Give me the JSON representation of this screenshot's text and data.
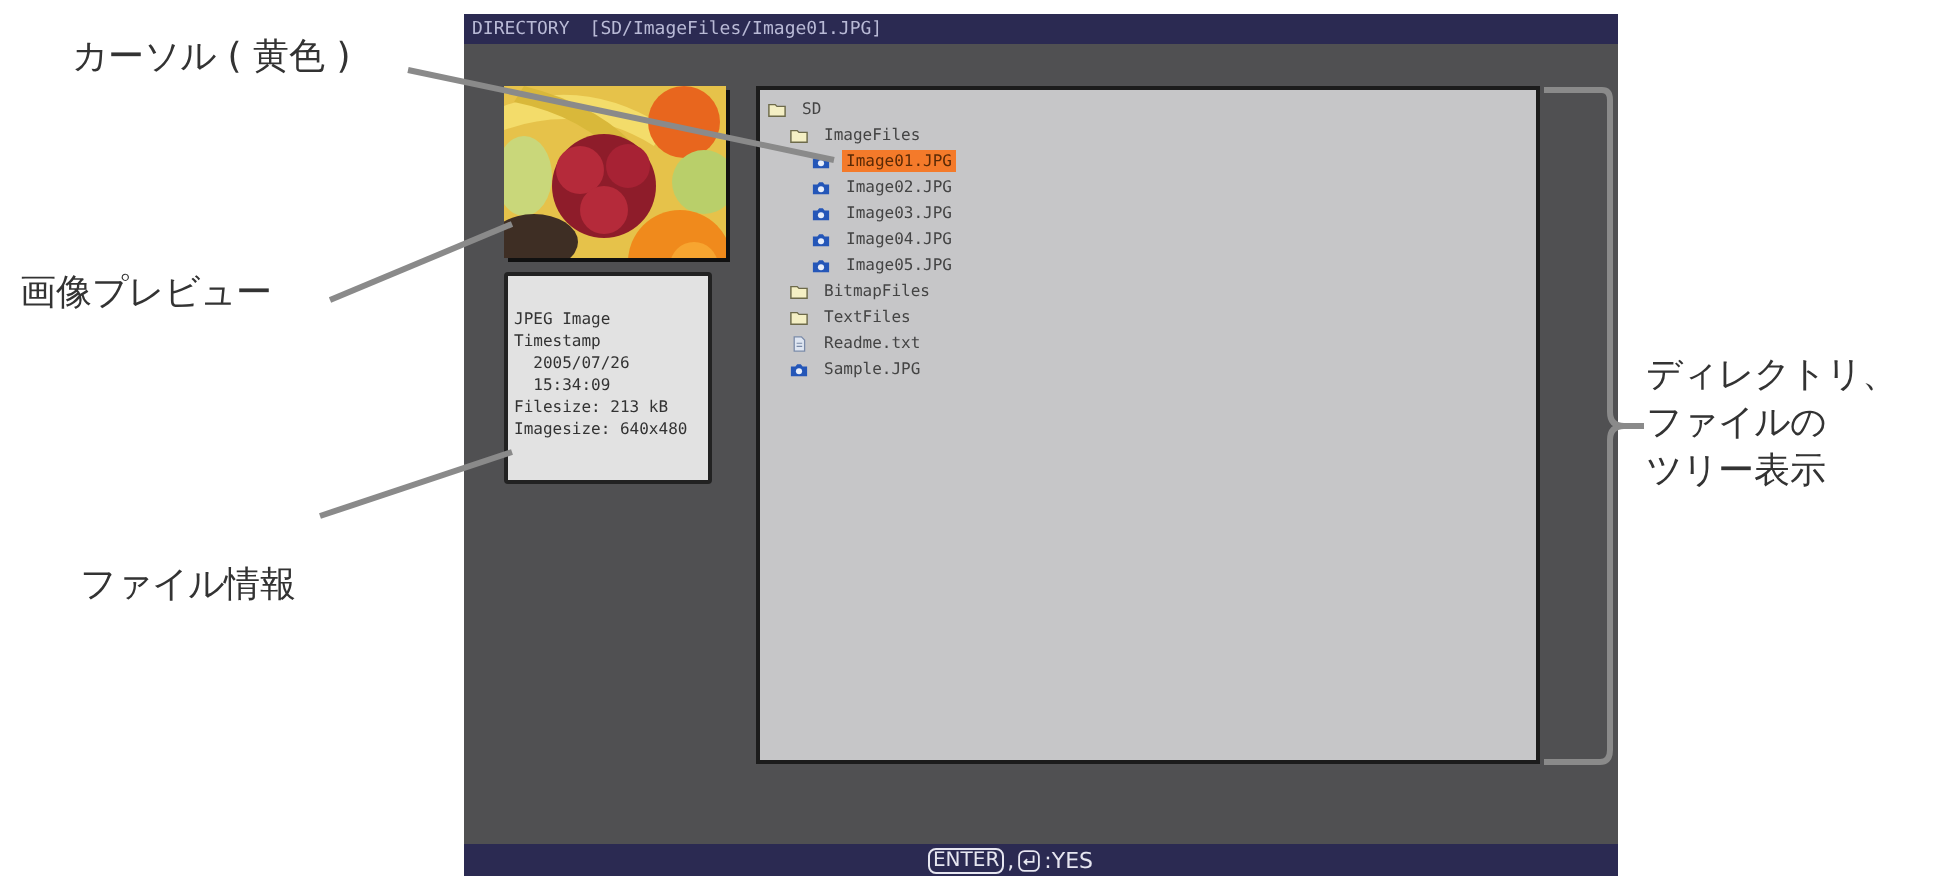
{
  "callouts": {
    "cursor": "カーソル ( 黄色 )",
    "preview": "画像プレビュー",
    "info": "ファイル情報",
    "tree": [
      "ディレクトリ、",
      "ファイルの",
      "ツリー表示"
    ]
  },
  "screen": {
    "title": "DIRECTORY",
    "path": "[SD/ImageFiles/Image01.JPG]",
    "file_info": [
      "JPEG Image",
      "Timestamp",
      "  2005/07/26",
      "  15:34:09",
      "Filesize: 213 kB",
      "Imagesize: 640x480"
    ],
    "tree": [
      {
        "label": "SD",
        "kind": "folder",
        "selected": false,
        "children": [
          {
            "label": "ImageFiles",
            "kind": "folder",
            "selected": false,
            "children": [
              {
                "label": "Image01.JPG",
                "selected": true
              },
              {
                "label": "Image02.JPG",
                "selected": false
              },
              {
                "label": "Image03.JPG",
                "selected": false
              },
              {
                "label": "Image04.JPG",
                "selected": false
              },
              {
                "label": "Image05.JPG",
                "selected": false
              }
            ]
          },
          {
            "label": "BitmapFiles",
            "kind": "folder",
            "selected": false
          },
          {
            "label": "TextFiles",
            "kind": "folder",
            "selected": false
          },
          {
            "label": "Readme.txt",
            "kind": "text",
            "selected": false
          },
          {
            "label": "Sample.JPG",
            "selected": false
          }
        ]
      }
    ],
    "footer": {
      "key": "ENTER",
      "separator": ",",
      "action": ":YES"
    }
  }
}
